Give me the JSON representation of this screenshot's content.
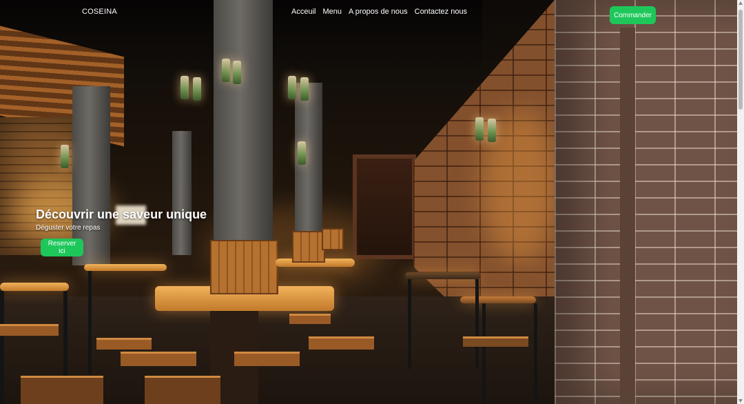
{
  "navbar": {
    "brand": "COSEINA",
    "links": [
      {
        "label": "Acceuil"
      },
      {
        "label": "Menu"
      },
      {
        "label": "A propos de nous"
      },
      {
        "label": "Contactez nous"
      }
    ],
    "order_button": "Commander"
  },
  "hero": {
    "title": "Découvrir une saveur unique",
    "subtitle": "Déguster votre repas",
    "reserve_button": "Reserver ici",
    "background": "restaurant-interior-image"
  },
  "colors": {
    "accent": "#1ec75a",
    "text": "#ffffff"
  }
}
